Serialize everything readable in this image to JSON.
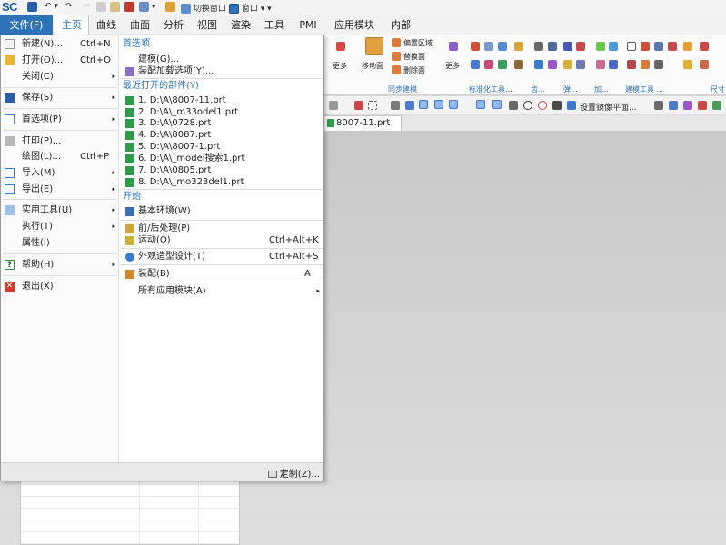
{
  "app": {
    "logo": "SC"
  },
  "qat": {
    "switch_window": "切换窗口",
    "window": "窗口",
    "window_caret": "▾ ▾"
  },
  "tabs": [
    {
      "label": "文件(F)",
      "kind": "file"
    },
    {
      "label": "主页",
      "kind": "active"
    },
    {
      "label": "曲线"
    },
    {
      "label": "曲面"
    },
    {
      "label": "分析"
    },
    {
      "label": "视图"
    },
    {
      "label": "渲染"
    },
    {
      "label": "工具"
    },
    {
      "label": "PMI"
    },
    {
      "label": "应用模块"
    },
    {
      "label": "内部"
    }
  ],
  "ribbon": {
    "more1": "更多",
    "move_face": "移动面",
    "offset_region": "偏置区域",
    "replace_face": "替换面",
    "delete_face": "删除面",
    "more2": "更多",
    "groups": {
      "sync": "同步建模",
      "std": "标准化工具...",
      "gear": "齿...",
      "spring": "弹...",
      "add": "加...",
      "build": "建模工具 ...",
      "dim": "尺寸"
    }
  },
  "selbar": {
    "mirror_plane": "设置镜像平面..."
  },
  "doc_tab": {
    "label": "8007-11.prt"
  },
  "file_menu": {
    "left": [
      {
        "label": "新建(N)...",
        "shortcut": "Ctrl+N",
        "icon": "new-file-icon",
        "color": "#e9e9e9"
      },
      {
        "label": "打开(O)...",
        "shortcut": "Ctrl+O",
        "icon": "open-folder-icon",
        "color": "#e8b53a"
      },
      {
        "label": "关闭(C)",
        "arrow": "▸",
        "icon": ""
      },
      {
        "label": "保存(S)",
        "arrow": "▸",
        "icon": "save-icon",
        "color": "#2a5fa8"
      },
      {
        "label": "首选项(P)",
        "arrow": "▸",
        "icon": "preferences-icon",
        "color": "#4a7cc7"
      },
      {
        "label": "打印(P)...",
        "icon": "print-icon",
        "color": "#888888"
      },
      {
        "label": "绘图(L)...",
        "shortcut": "Ctrl+P",
        "icon": ""
      },
      {
        "label": "导入(M)",
        "arrow": "▸",
        "icon": "import-icon",
        "color": "#3c77c9"
      },
      {
        "label": "导出(E)",
        "arrow": "▸",
        "icon": "export-icon",
        "color": "#3c77c9"
      },
      {
        "label": "实用工具(U)",
        "arrow": "▸",
        "icon": "utility-icon",
        "color": "#5a8fd6"
      },
      {
        "label": "执行(T)",
        "arrow": "▸",
        "icon": ""
      },
      {
        "label": "属性(I)",
        "icon": ""
      },
      {
        "label": "帮助(H)",
        "arrow": "▸",
        "icon": "help-icon",
        "color": "#3a8f3a",
        "glyph": "?"
      },
      {
        "label": "退出(X)",
        "icon": "exit-icon",
        "color": "#d63a2a",
        "glyph": "✕"
      }
    ],
    "right": {
      "prefs_header": "首选项",
      "prefs": [
        {
          "label": "建模(G)...",
          "icon": ""
        },
        {
          "label": "装配加载选项(Y)...",
          "icon": "assembly-load-icon",
          "color": "#8a6fc2"
        }
      ],
      "recent_header": "最近打开的部件(Y)",
      "recent": [
        "1. D:\\A\\8007-11.prt",
        "2. D:\\A\\_m33odel1.prt",
        "3. D:\\A\\0728.prt",
        "4. D:\\A\\8087.prt",
        "5. D:\\A\\8007-1.prt",
        "6. D:\\A\\_model搜索1.prt",
        "7. D:\\A\\0805.prt",
        "8. D:\\A\\_mo323del1.prt"
      ],
      "start_header": "开始",
      "start": [
        {
          "label": "基本环境(W)",
          "icon": "basic-env-icon",
          "color": "#3d6fb5"
        },
        {
          "label": "前/后处理(P)",
          "icon": "pre-post-icon",
          "color": "#d4a23a"
        },
        {
          "label": "运动(O)",
          "shortcut": "Ctrl+Alt+K",
          "icon": "motion-icon",
          "color": "#c9b23a"
        },
        {
          "label": "外观造型设计(T)",
          "shortcut": "Ctrl+Alt+S",
          "icon": "shape-studio-icon",
          "color": "#3a7cd4"
        },
        {
          "label": "装配(B)",
          "shortcut": "A",
          "icon": "assembly-icon",
          "color": "#d08a2a"
        },
        {
          "label": "所有应用模块(A)",
          "arrow": "▸",
          "icon": ""
        }
      ],
      "customize": "定制(Z)..."
    }
  },
  "colors": {
    "accent": "#2e73b8",
    "file_tab": "#2e73b8",
    "part_icon": "#2f9a4a"
  }
}
